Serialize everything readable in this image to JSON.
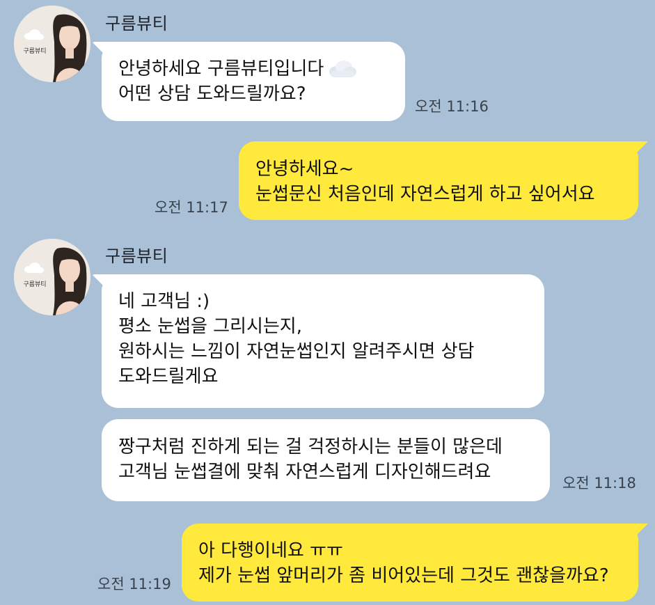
{
  "profile": {
    "name": "구름뷰티",
    "avatar_text": "구름뷰티",
    "avatar_icon": "cloud-icon"
  },
  "messages": [
    {
      "side": "left",
      "lines": [
        "안녕하세요 구름뷰티입니다",
        "어떤 상담 도와드릴까요?"
      ],
      "emoji": "cloud-emoji",
      "time": "오전 11:16"
    },
    {
      "side": "right",
      "lines": [
        "안녕하세요~",
        "눈썹문신 처음인데 자연스럽게 하고 싶어서요"
      ],
      "time": "오전 11:17"
    },
    {
      "side": "left",
      "lines": [
        "네 고객님 :)",
        "평소 눈썹을 그리시는지,",
        "원하시는 느낌이 자연눈썹인지 알려주시면 상담",
        "도와드릴게요"
      ],
      "time": ""
    },
    {
      "side": "left",
      "lines": [
        "짱구처럼 진하게 되는 걸 걱정하시는 분들이 많은데",
        "고객님 눈썹결에 맞춰 자연스럽게 디자인해드려요"
      ],
      "time": "오전 11:18"
    },
    {
      "side": "right",
      "lines": [
        "아 다행이네요 ㅠㅠ",
        "제가 눈썹 앞머리가 좀 비어있는데 그것도 괜찮을까요?"
      ],
      "time": "오전 11:19"
    }
  ],
  "colors": {
    "background": "#a9c0d6",
    "incoming_bubble": "#ffffff",
    "outgoing_bubble": "#fee93c",
    "timestamp": "#38424d"
  }
}
